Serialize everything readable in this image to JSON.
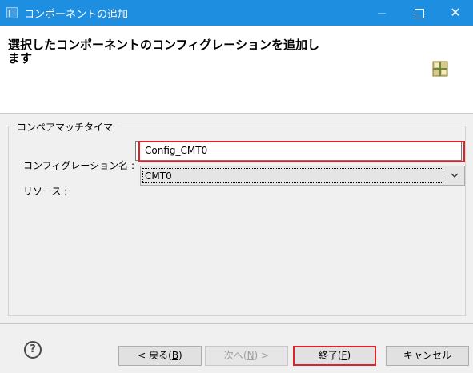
{
  "window": {
    "title": "コンポーネントの追加",
    "close_glyph": "✕"
  },
  "banner": {
    "title": "選択したコンポーネントのコンフィグレーションを追加します"
  },
  "group": {
    "label": "コンペアマッチタイマ",
    "config_label": "コンフィグレーション名 :",
    "config_value": "Config_CMT0",
    "resource_label": "リソース :",
    "resource_value": "CMT0"
  },
  "footer": {
    "help_glyph": "?",
    "back_text": "< 戻る(",
    "back_key": "B",
    "back_end": ")",
    "next_text": "次へ(",
    "next_key": "N",
    "next_end": ") >",
    "finish_text": "終了(",
    "finish_key": "F",
    "finish_end": ")",
    "cancel": "キャンセル"
  },
  "colors": {
    "titlebar": "#1e8ee0",
    "highlight": "#e0202a"
  },
  "icons": {
    "app": "window-app-icon",
    "banner": "component-grid-icon",
    "help": "help-icon",
    "dropdown": "chevron-down-icon"
  }
}
